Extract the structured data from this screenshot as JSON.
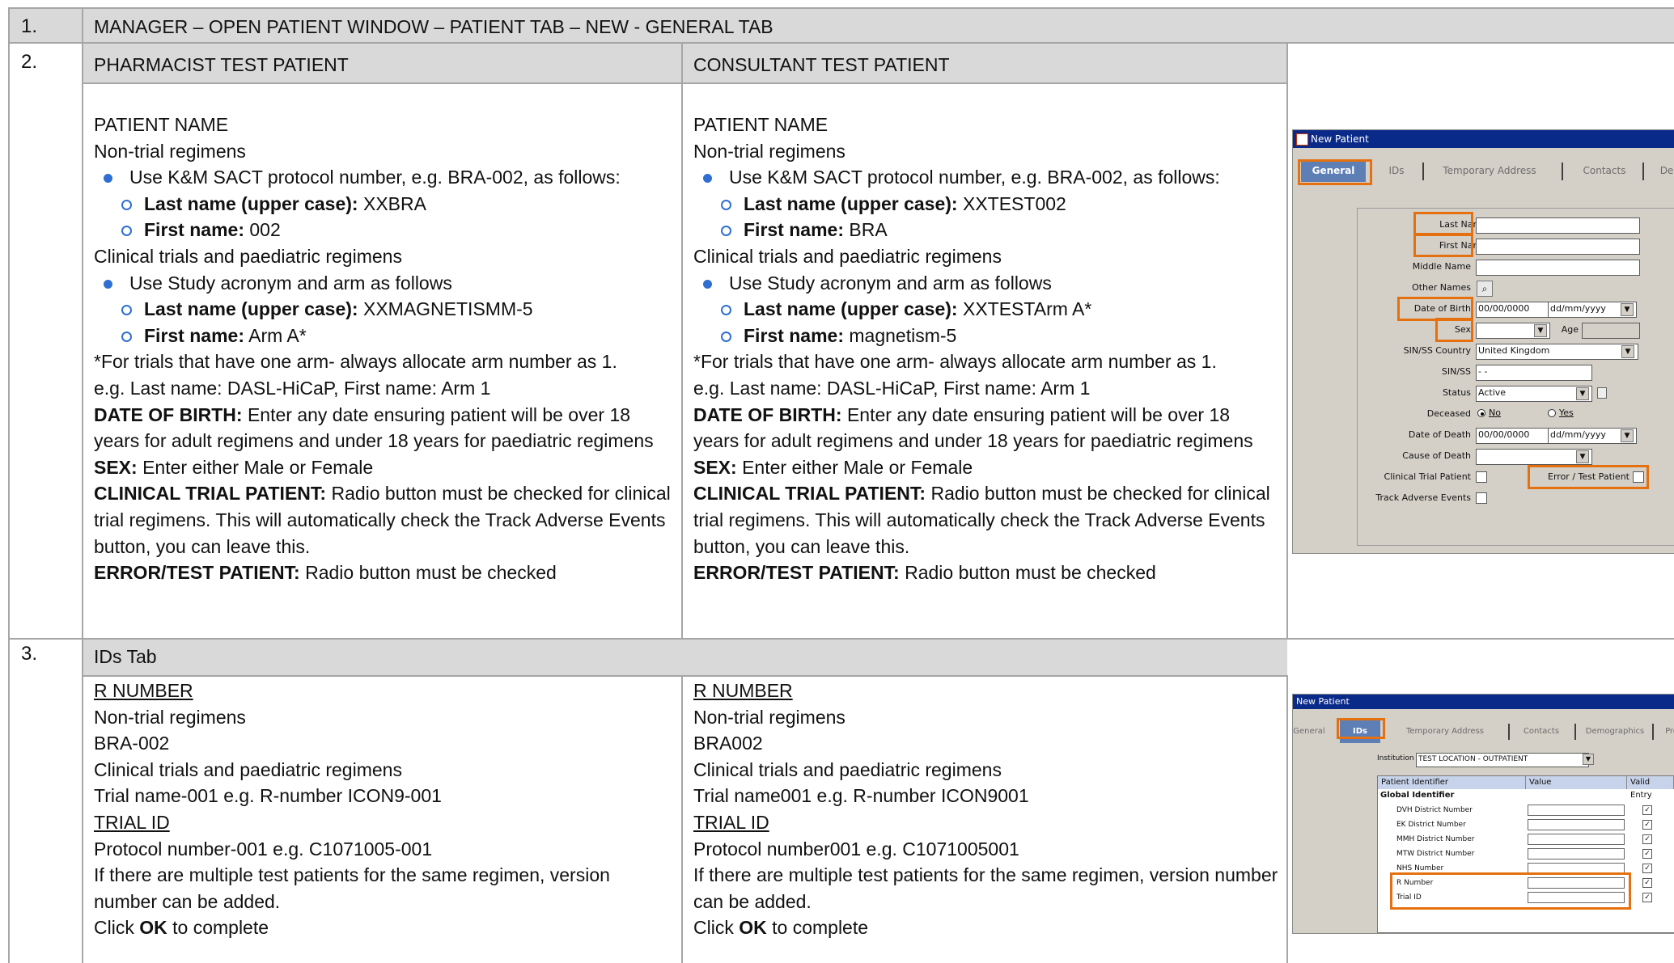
{
  "rows": [
    {
      "num": "1.",
      "title": "MANAGER – OPEN PATIENT WINDOW – PATIENT TAB – NEW - GENERAL TAB"
    },
    {
      "num": "2."
    },
    {
      "num": "3.",
      "title": "IDs Tab"
    }
  ],
  "general": {
    "pharmacist": {
      "header": "PHARMACIST TEST PATIENT",
      "patient_name": "PATIENT NAME",
      "nontrial": "Non-trial regimens",
      "bullet1": "Use K&M SACT protocol number, e.g. BRA-002, as follows:",
      "last_label": "Last name (upper case):",
      "last_value": " XXBRA",
      "first_label": "First name:",
      "first_value": " 002",
      "trials": "Clinical trials and paediatric regimens",
      "bullet2": "Use Study acronym and arm as follows",
      "last2_label": "Last name (upper case):",
      "last2_value": " XXMAGNETISMM-5",
      "first2_label": "First name:",
      "first2_value": " Arm A*",
      "note1": "*For trials that have one arm- always allocate arm number as 1.",
      "note2": "e.g. Last name: DASL-HiCaP, First name: Arm 1",
      "dob_label": "DATE OF BIRTH:",
      "dob_text": " Enter any date ensuring patient will be over 18 years for adult regimens and under 18 years for paediatric regimens",
      "sex_label": "SEX:",
      "sex_text": " Enter either Male or Female",
      "ctp_label": "CLINICAL TRIAL PATIENT:",
      "ctp_text": " Radio button must be checked for clinical trial regimens. This will automatically check the Track Adverse Events button, you can leave this.",
      "err_label": "ERROR/TEST PATIENT:",
      "err_text": "  Radio button must be checked"
    },
    "consultant": {
      "header": "CONSULTANT TEST PATIENT",
      "patient_name": "PATIENT NAME",
      "nontrial": "Non-trial regimens",
      "bullet1": "Use K&M SACT protocol number, e.g. BRA-002, as follows:",
      "last_label": "Last name (upper case):",
      "last_value": " XXTEST002",
      "first_label": "First name:",
      "first_value": " BRA",
      "trials": "Clinical trials and paediatric regimens",
      "bullet2": "Use Study acronym and arm as follows",
      "last2_label": "Last name (upper case):",
      "last2_value": "  XXTESTArm A*",
      "first2_label": "First name:",
      "first2_value": " magnetism-5",
      "note1": "*For trials that have one arm- always allocate arm number as 1.",
      "note2": "e.g. Last name: DASL-HiCaP, First name: Arm 1",
      "dob_label": "DATE OF BIRTH:",
      "dob_text": " Enter any date ensuring patient will be over 18 years for adult regimens and under 18 years for paediatric regimens",
      "sex_label": "SEX:",
      "sex_text": " Enter either Male or Female",
      "ctp_label": "CLINICAL TRIAL PATIENT:",
      "ctp_text": " Radio button must be checked for clinical trial regimens. This will automatically check the Track Adverse Events button, you can leave this.",
      "err_label": "ERROR/TEST PATIENT:",
      "err_text": "  Radio button must be checked"
    }
  },
  "ids": {
    "pharmacist": {
      "rnumber": "R NUMBER",
      "nontrial": "Non-trial regimens",
      "nontrial_value": "BRA-002",
      "trials": "Clinical trials and paediatric regimens",
      "trials_value": "Trial name-001 e.g. R-number ICON9-001",
      "trialid": "TRIAL ID",
      "trialid_value": "Protocol number-001 e.g.  C1071005-001",
      "multi": "If there are multiple test patients for the same regimen, version number can be added.",
      "click": "Click ",
      "ok": "OK",
      "complete": " to complete"
    },
    "consultant": {
      "rnumber": "R NUMBER",
      "nontrial": "Non-trial regimens",
      "nontrial_value": "BRA002",
      "trials": "Clinical trials and paediatric regimens",
      "trials_value": "Trial name001 e.g. R-number ICON9001",
      "trialid": "TRIAL ID",
      "trialid_value": "Protocol number001 e.g. C1071005001",
      "multi": "If there are multiple test patients for the same regimen, version number can be added.",
      "click": "Click ",
      "ok": "OK",
      "complete": " to complete"
    }
  },
  "screenshot1": {
    "title": "New Patient",
    "tabs": [
      "General",
      "IDs",
      "Temporary Address",
      "Contacts",
      "De"
    ],
    "labels": {
      "last_name": "Last Name",
      "first_name": "First Name",
      "middle_name": "Middle Name",
      "other_names": "Other Names",
      "dob": "Date of Birth",
      "sex": "Sex",
      "age": "Age",
      "country": "SIN/SS Country",
      "sinss": "SIN/SS",
      "status": "Status",
      "deceased": "Deceased",
      "no": "No",
      "yes": "Yes",
      "dod": "Date of Death",
      "cause": "Cause of Death",
      "clinical_trial": "Clinical Trial Patient",
      "error_test": "Error / Test Patient",
      "track": "Track Adverse Events"
    },
    "values": {
      "dob": "00/00/0000",
      "dob_fmt": "dd/mm/yyyy",
      "country": "United Kingdom",
      "sinss": " - -",
      "status": "Active",
      "dod": "00/00/0000",
      "dod_fmt": "dd/mm/yyyy"
    }
  },
  "screenshot2": {
    "title": "New Patient",
    "tabs": [
      "General",
      "IDs",
      "Temporary Address",
      "Contacts",
      "Demographics",
      "Pro"
    ],
    "institution_label": "Institution",
    "institution_value": "TEST LOCATION - OUTPATIENT",
    "columns": [
      "Patient Identifier",
      "Value",
      "Valid Entry"
    ],
    "group": "Global Identifier",
    "items": [
      "DVH District Number",
      "EK District Number",
      "MMH District Number",
      "MTW District Number",
      "NHS Number",
      "R Number",
      "Trial ID"
    ],
    "check": "✓"
  },
  "colors": {
    "highlight": "#e5700f",
    "header_bg": "#d9d9d9",
    "bullet": "#2f6fd1",
    "tab_active": "#5d7fb6"
  }
}
